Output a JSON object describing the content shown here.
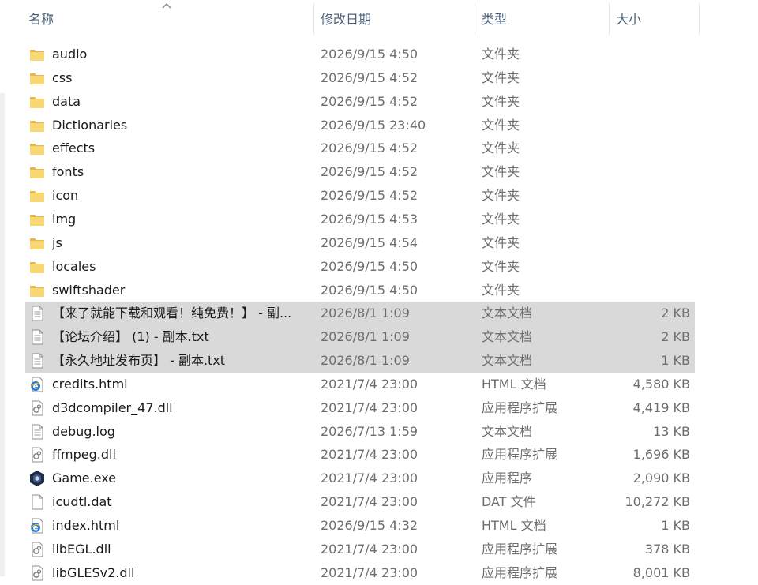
{
  "columns": {
    "name": "名称",
    "date": "修改日期",
    "type": "类型",
    "size": "大小"
  },
  "files": [
    {
      "icon": "folder-icon",
      "name": "audio",
      "date": "2026/9/15 4:50",
      "type": "文件夹",
      "size": ""
    },
    {
      "icon": "folder-icon",
      "name": "css",
      "date": "2026/9/15 4:52",
      "type": "文件夹",
      "size": ""
    },
    {
      "icon": "folder-icon",
      "name": "data",
      "date": "2026/9/15 4:52",
      "type": "文件夹",
      "size": ""
    },
    {
      "icon": "folder-icon",
      "name": "Dictionaries",
      "date": "2026/9/15 23:40",
      "type": "文件夹",
      "size": ""
    },
    {
      "icon": "folder-icon",
      "name": "effects",
      "date": "2026/9/15 4:52",
      "type": "文件夹",
      "size": ""
    },
    {
      "icon": "folder-icon",
      "name": "fonts",
      "date": "2026/9/15 4:52",
      "type": "文件夹",
      "size": ""
    },
    {
      "icon": "folder-icon",
      "name": "icon",
      "date": "2026/9/15 4:52",
      "type": "文件夹",
      "size": ""
    },
    {
      "icon": "folder-icon",
      "name": "img",
      "date": "2026/9/15 4:53",
      "type": "文件夹",
      "size": ""
    },
    {
      "icon": "folder-icon",
      "name": "js",
      "date": "2026/9/15 4:54",
      "type": "文件夹",
      "size": ""
    },
    {
      "icon": "folder-icon",
      "name": "locales",
      "date": "2026/9/15 4:50",
      "type": "文件夹",
      "size": ""
    },
    {
      "icon": "folder-icon",
      "name": "swiftshader",
      "date": "2026/9/15 4:50",
      "type": "文件夹",
      "size": ""
    },
    {
      "icon": "text-file-icon",
      "name": "【来了就能下载和观看！纯免费！】 - 副...",
      "date": "2026/8/1 1:09",
      "type": "文本文档",
      "size": "2 KB",
      "selected": true
    },
    {
      "icon": "text-file-icon",
      "name": "【论坛介绍】 (1) - 副本.txt",
      "date": "2026/8/1 1:09",
      "type": "文本文档",
      "size": "2 KB",
      "selected": true
    },
    {
      "icon": "text-file-icon",
      "name": "【永久地址发布页】 - 副本.txt",
      "date": "2026/8/1 1:09",
      "type": "文本文档",
      "size": "1 KB",
      "selected": true
    },
    {
      "icon": "html-file-icon",
      "name": "credits.html",
      "date": "2021/7/4 23:00",
      "type": "HTML 文档",
      "size": "4,580 KB"
    },
    {
      "icon": "dll-file-icon",
      "name": "d3dcompiler_47.dll",
      "date": "2021/7/4 23:00",
      "type": "应用程序扩展",
      "size": "4,419 KB"
    },
    {
      "icon": "text-file-icon",
      "name": "debug.log",
      "date": "2026/7/13 1:59",
      "type": "文本文档",
      "size": "13 KB"
    },
    {
      "icon": "dll-file-icon",
      "name": "ffmpeg.dll",
      "date": "2021/7/4 23:00",
      "type": "应用程序扩展",
      "size": "1,696 KB"
    },
    {
      "icon": "game-exe-icon",
      "name": "Game.exe",
      "date": "2021/7/4 23:00",
      "type": "应用程序",
      "size": "2,090 KB"
    },
    {
      "icon": "blank-file-icon",
      "name": "icudtl.dat",
      "date": "2021/7/4 23:00",
      "type": "DAT 文件",
      "size": "10,272 KB"
    },
    {
      "icon": "html-file-icon",
      "name": "index.html",
      "date": "2026/9/15 4:32",
      "type": "HTML 文档",
      "size": "1 KB"
    },
    {
      "icon": "dll-file-icon",
      "name": "libEGL.dll",
      "date": "2021/7/4 23:00",
      "type": "应用程序扩展",
      "size": "378 KB"
    },
    {
      "icon": "dll-file-icon",
      "name": "libGLESv2.dll",
      "date": "2021/7/4 23:00",
      "type": "应用程序扩展",
      "size": "8,001 KB"
    }
  ],
  "colors": {
    "header_text": "#4c607a",
    "selected_row": "#d9d9d9",
    "folder": "#f8d775",
    "secondary_text": "#6d6d6d"
  }
}
